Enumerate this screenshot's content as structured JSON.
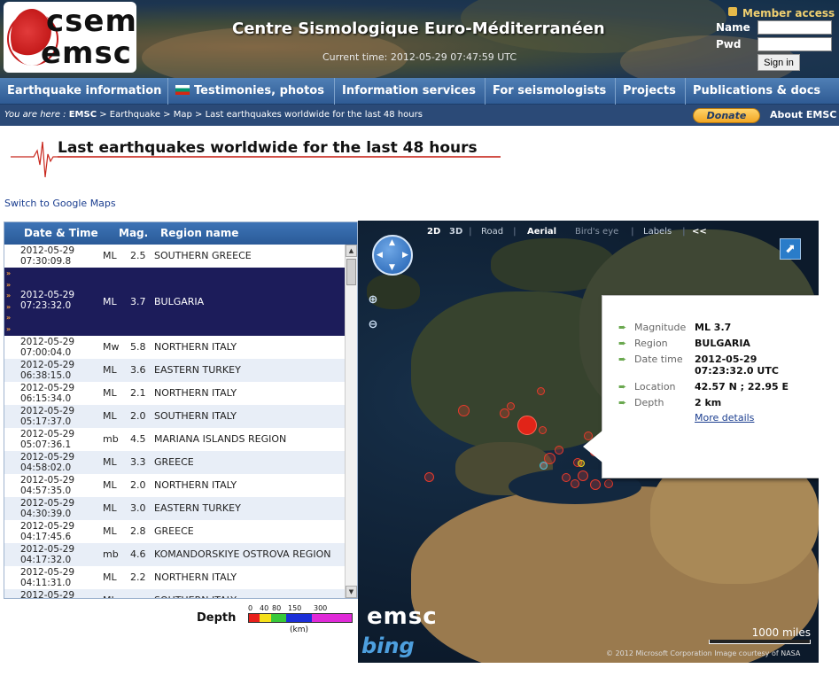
{
  "header": {
    "logo_line1": "csem",
    "logo_line2": "emsc",
    "site_title": "Centre Sismologique Euro-Méditerranéen",
    "current_time": "Current time: 2012-05-29 07:47:59 UTC",
    "member_access": "Member access",
    "name_label": "Name",
    "pwd_label": "Pwd",
    "signin_label": "Sign in"
  },
  "nav": {
    "items": [
      "Earthquake information",
      "Testimonies, photos",
      "Information services",
      "For seismologists",
      "Projects",
      "Publications & docs"
    ]
  },
  "breadcrumb": {
    "prefix": "You are here :",
    "root": "EMSC",
    "rest": " > Earthquake > Map > Last earthquakes worldwide for the last 48 hours",
    "donate": "Donate",
    "about": "About EMSC"
  },
  "page": {
    "title": "Last earthquakes worldwide for the last 48 hours",
    "switch_link": "Switch to Google Maps"
  },
  "table": {
    "headers": [
      "Date & Time",
      "Mag.",
      "Region name"
    ],
    "selected_marks": "»\n»\n»\n»\n»\n»",
    "rows": [
      {
        "date": "2012-05-29",
        "time": "07:30:09.8",
        "type": "ML",
        "mag": "2.5",
        "region": "SOUTHERN GREECE"
      },
      {
        "date": "2012-05-29",
        "time": "07:23:32.0",
        "type": "ML",
        "mag": "3.7",
        "region": "BULGARIA"
      },
      {
        "date": "2012-05-29",
        "time": "07:00:04.0",
        "type": "Mw",
        "mag": "5.8",
        "region": "NORTHERN ITALY"
      },
      {
        "date": "2012-05-29",
        "time": "06:38:15.0",
        "type": "ML",
        "mag": "3.6",
        "region": "EASTERN TURKEY"
      },
      {
        "date": "2012-05-29",
        "time": "06:15:34.0",
        "type": "ML",
        "mag": "2.1",
        "region": "NORTHERN ITALY"
      },
      {
        "date": "2012-05-29",
        "time": "05:17:37.0",
        "type": "ML",
        "mag": "2.0",
        "region": "SOUTHERN ITALY"
      },
      {
        "date": "2012-05-29",
        "time": "05:07:36.1",
        "type": "mb",
        "mag": "4.5",
        "region": "MARIANA ISLANDS REGION"
      },
      {
        "date": "2012-05-29",
        "time": "04:58:02.0",
        "type": "ML",
        "mag": "3.3",
        "region": "GREECE"
      },
      {
        "date": "2012-05-29",
        "time": "04:57:35.0",
        "type": "ML",
        "mag": "2.0",
        "region": "NORTHERN ITALY"
      },
      {
        "date": "2012-05-29",
        "time": "04:30:39.0",
        "type": "ML",
        "mag": "3.0",
        "region": "EASTERN TURKEY"
      },
      {
        "date": "2012-05-29",
        "time": "04:17:45.6",
        "type": "ML",
        "mag": "2.8",
        "region": "GREECE"
      },
      {
        "date": "2012-05-29",
        "time": "04:17:32.0",
        "type": "mb",
        "mag": "4.6",
        "region": "KOMANDORSKIYE OSTROVA REGION"
      },
      {
        "date": "2012-05-29",
        "time": "04:11:31.0",
        "type": "ML",
        "mag": "2.2",
        "region": "NORTHERN ITALY"
      },
      {
        "date": "2012-05-29",
        "time": "",
        "type": "ML",
        "mag": "",
        "region": "SOUTHERN ITALY"
      }
    ],
    "selected_index": 1
  },
  "depth_legend": {
    "label": "Depth",
    "ticks": [
      "0",
      "40",
      "80",
      "150",
      "300"
    ],
    "unit": "(km)",
    "colors": [
      "#e8201c",
      "#f5e01a",
      "#38c83a",
      "#1c2fd8",
      "#e02ad8"
    ]
  },
  "map": {
    "toolbar": {
      "view_2d": "2D",
      "view_3d": "3D",
      "road": "Road",
      "aerial": "Aerial",
      "birds_eye": "Bird's eye",
      "labels": "Labels",
      "collapse": "<<"
    },
    "popup": {
      "magnitude_label": "Magnitude",
      "magnitude": "ML 3.7",
      "region_label": "Region",
      "region": "BULGARIA",
      "date_label": "Date time",
      "date_line1": "2012-05-29",
      "date_line2": "07:23:32.0 UTC",
      "location_label": "Location",
      "location": "42.57 N ; 22.95 E",
      "depth_label": "Depth",
      "depth": "2 km",
      "more": "More details"
    },
    "emsc_logo": "emsc",
    "bing_logo": "bing",
    "scale": "1000 miles",
    "copyright": "© 2012 Microsoft Corporation   Image courtesy of NASA"
  }
}
